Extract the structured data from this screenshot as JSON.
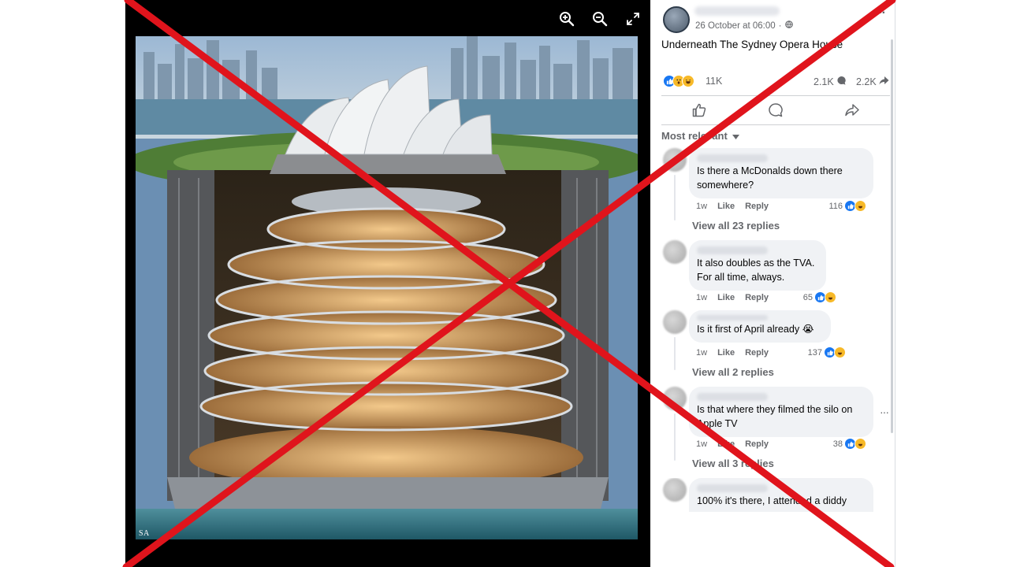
{
  "viewer": {
    "watermark": "SA",
    "toolbar": [
      "zoom-in-icon",
      "zoom-out-icon",
      "fullscreen-icon"
    ]
  },
  "post": {
    "timestamp": "26 October at 06:00",
    "separator": "·",
    "text": "Underneath The Sydney Opera House",
    "reactions": {
      "icons": [
        "like-icon",
        "wow-icon",
        "haha-icon"
      ],
      "count": "11K"
    },
    "comments_count": "2.1K",
    "shares_count": "2.2K",
    "sort_label": "Most relevant"
  },
  "comments": [
    {
      "text_line1": "Is there a McDonalds down there",
      "text_line2": "somewhere?",
      "time": "1w",
      "like": "Like",
      "reply": "Reply",
      "reactions": "116",
      "replies": "View all 23 replies"
    },
    {
      "text_line1": "It also doubles as the TVA.",
      "text_line2": "For all time, always.",
      "time": "1w",
      "like": "Like",
      "reply": "Reply",
      "reactions": "65"
    },
    {
      "text_line1": "Is it first of April already",
      "emoji": "😭",
      "time": "1w",
      "like": "Like",
      "reply": "Reply",
      "reactions": "137",
      "replies": "View all 2 replies"
    },
    {
      "text_line1": "Is that where they filmed the silo on",
      "text_line2": "Apple TV",
      "time": "1w",
      "like": "Like",
      "reply": "Reply",
      "reactions": "38",
      "replies": "View all 3 replies"
    },
    {
      "text_line1": "100% it's there, I attended a diddy"
    }
  ],
  "colors": {
    "cross": "#e0141c",
    "like_blue": "#1877f2",
    "haha_yellow": "#f7b928"
  }
}
